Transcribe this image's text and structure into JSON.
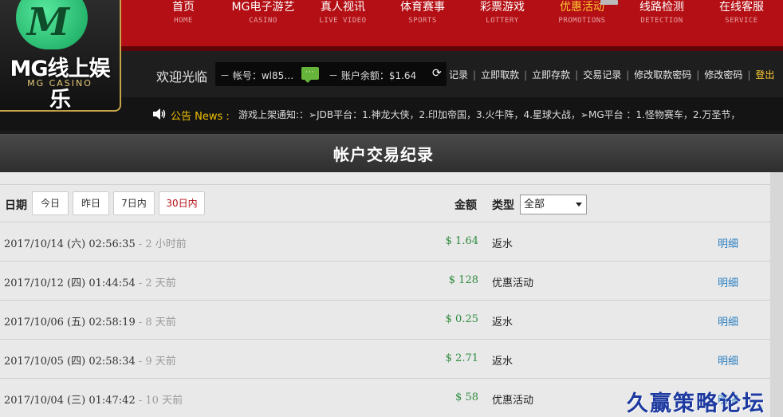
{
  "nav": {
    "items": [
      {
        "cn": "首页",
        "en": "HOME"
      },
      {
        "cn": "MG电子游艺",
        "en": "CASINO"
      },
      {
        "cn": "真人视讯",
        "en": "LIVE VIDEO"
      },
      {
        "cn": "体育赛事",
        "en": "SPORTS"
      },
      {
        "cn": "彩票游戏",
        "en": "LOTTERY"
      },
      {
        "cn": "优惠活动",
        "en": "PROMOTIONS"
      },
      {
        "cn": "线路检测",
        "en": "DETECTION"
      },
      {
        "cn": "在线客服",
        "en": "SERVICE"
      }
    ],
    "active_color": "#ffcc33",
    "bar_color": "#b40f14"
  },
  "logo": {
    "mark": "M",
    "cn": "MG线上娱乐",
    "en": "MG CASINO"
  },
  "account": {
    "welcome": "欢迎光临",
    "account_label": "－ 帐号：",
    "account_value": "wl85…",
    "balance_label": "－ 账户余额：",
    "balance_value": "$1.64"
  },
  "links": {
    "items": [
      "记录",
      "立即取款",
      "立即存款",
      "交易记录",
      "修改取款密码",
      "修改密码"
    ],
    "logout": "登出"
  },
  "notice": {
    "label": "公告 News :",
    "text": "游戏上架通知:：➢JDB平台：1.神龙大侠，2.印加帝国，3.火牛阵，4.星球大战，➢MG平台 ：1.怪物赛车，2.万圣节，"
  },
  "panel": {
    "title": "帐户交易纪录",
    "filter_label": "日期",
    "filters": [
      "今日",
      "昨日",
      "7日内",
      "30日内"
    ],
    "amount_header": "金额",
    "type_header": "类型",
    "type_selected": "全部"
  },
  "rows": [
    {
      "date": "2017/10/14 (六) 02:56:35",
      "ago": " - 2 小时前",
      "amount": "$ 1.64",
      "type": "返水",
      "detail": "明细"
    },
    {
      "date": "2017/10/12 (四) 01:44:54",
      "ago": " - 2 天前",
      "amount": "$ 128",
      "type": "优惠活动",
      "detail": "明细"
    },
    {
      "date": "2017/10/06 (五) 02:58:19",
      "ago": " - 8 天前",
      "amount": "$ 0.25",
      "type": "返水",
      "detail": "明细"
    },
    {
      "date": "2017/10/05 (四) 02:58:34",
      "ago": " - 9 天前",
      "amount": "$ 2.71",
      "type": "返水",
      "detail": "明细"
    },
    {
      "date": "2017/10/04 (三) 01:47:42",
      "ago": " - 10 天前",
      "amount": "$ 58",
      "type": "优惠活动",
      "detail": "明细"
    }
  ],
  "watermark": "久赢策略论坛"
}
